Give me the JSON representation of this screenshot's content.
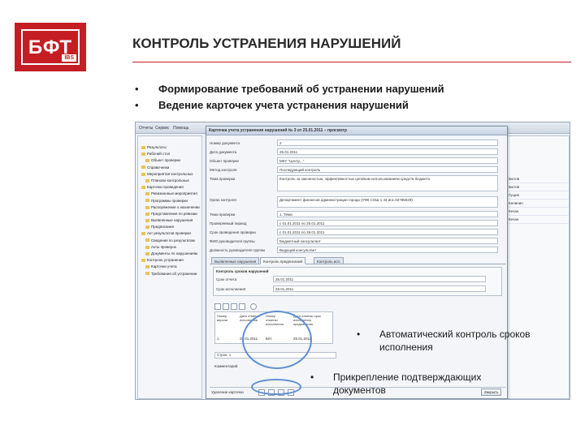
{
  "logo": {
    "text": "БФТ",
    "sub": "IBS"
  },
  "title": "КОНТРОЛЬ УСТРАНЕНИЯ НАРУШЕНИЙ",
  "bullets": [
    "Формирование требований об устранении нарушений",
    "Ведение карточек учета устранения нарушений"
  ],
  "app": {
    "menubar": [
      "Отчеты",
      "Сервис",
      "Помощь"
    ],
    "tree_items": [
      "Результаты",
      "Рабочий стол",
      "Объект проверки",
      "Справочники",
      "Мероприятия контрольных",
      "Планово-контрольные",
      "Карточки проведения",
      "Ревизионные мероприятия",
      "Программы проверки",
      "Распоряжение о назначении",
      "Представления по ревизии",
      "Выявленные нарушения",
      "Предписания",
      "Акт результатов проверки",
      "Сведения по результатам",
      "Акты проверок",
      "Документы по нарушениям",
      "Контроль устранения",
      "Карточки учета",
      "Требования об устранении"
    ],
    "grid_values": [
      "Бютов",
      "Бютов",
      "Гущин",
      "Калинин",
      "Кечан",
      "Кечан"
    ],
    "dialog_title": "Карточка учета устранения нарушений № 3 от 25.01.2011 – просмотр",
    "fields": [
      {
        "label": "Номер документа",
        "value": "2"
      },
      {
        "label": "Дата документа",
        "value": "25.01.2011"
      },
      {
        "label": "Объект проверки",
        "value": "МКУ \"Центр...\""
      },
      {
        "label": "Метод контроля",
        "value": "Последующий контроль"
      },
      {
        "label": "Тема проверки",
        "value": "Контроль за законностью, эффективностью целевым использованием средств бюджета"
      },
      {
        "label": "Орган контроля",
        "value": "Департамент финансов администрации города (УФК СОШ 1 44 инс.02785029)"
      },
      {
        "label": "Тема проверки",
        "value": "1. Тема"
      },
      {
        "label": "Проверяемый период",
        "value": "с 01.01.2011 по 25.01.2011"
      },
      {
        "label": "Срок проведения проверки",
        "value": "с 01.01.2011 по 25.01.2011"
      },
      {
        "label": "ФИО руководителя группы",
        "value": "Бюджетный консультант"
      },
      {
        "label": "Должность руководителя группы",
        "value": "Ведущий консультант"
      }
    ],
    "tabs": [
      "Выявленные нарушения",
      "Контроль предписаний",
      "Контроль исп."
    ],
    "sub_header": "Контроль сроков нарушений",
    "sub_fields": [
      {
        "label": "Срок отчета",
        "value": "25.01.2011"
      },
      {
        "label": "Срок исполнения",
        "value": "28.01.2011"
      }
    ],
    "table_headers": [
      "Номер версии",
      "Дата отметки исполнения",
      "Номер отметки исполнения",
      "Дата отметки срок исполнения предписания"
    ],
    "table_row": [
      "1",
      "25.01.2011",
      "Б/Н",
      "25.01.2011"
    ],
    "count_label": "Строк: 1",
    "attachments_label": "Комментарий",
    "bottom_label": "Удаление карточки",
    "close_button": "Закрыть"
  },
  "callouts": [
    "Автоматический контроль сроков исполнения",
    "Прикрепление подтверждающих документов"
  ],
  "colors": {
    "accent": "#c41e24",
    "highlight": "#5f8fd1"
  }
}
